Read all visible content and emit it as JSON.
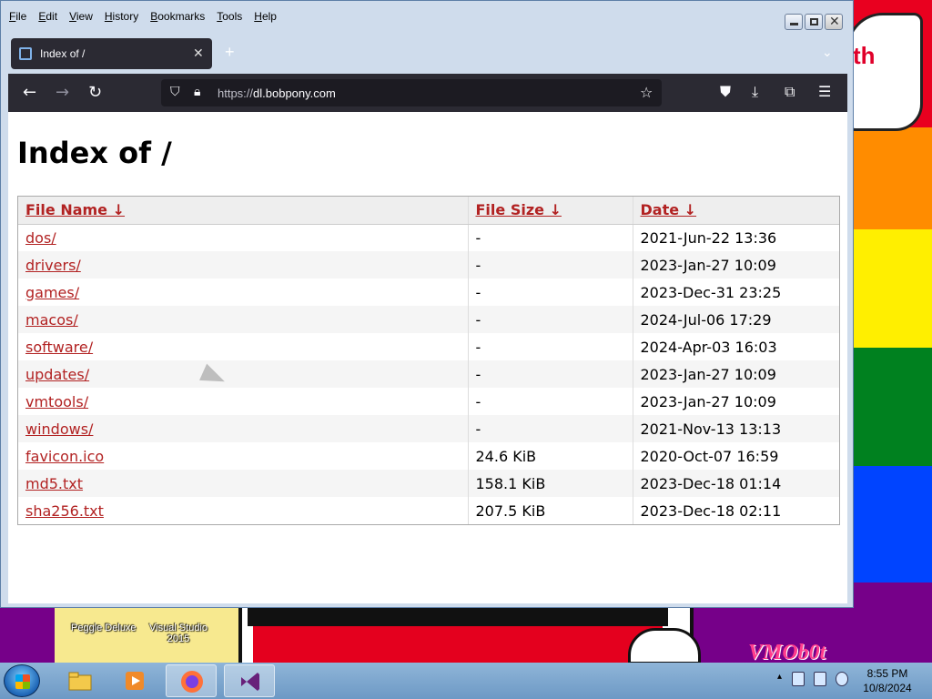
{
  "window": {
    "menu": [
      "File",
      "Edit",
      "View",
      "History",
      "Bookmarks",
      "Tools",
      "Help"
    ]
  },
  "tab": {
    "title": "Index of /"
  },
  "url": {
    "scheme": "https://",
    "host": "dl.bobpony.com"
  },
  "page": {
    "title": "Index of /",
    "headers": {
      "name": "File Name  ↓",
      "size": "File Size  ↓",
      "date": "Date  ↓"
    },
    "rows": [
      {
        "name": "dos/",
        "size": "-",
        "date": "2021-Jun-22 13:36"
      },
      {
        "name": "drivers/",
        "size": "-",
        "date": "2023-Jan-27 10:09"
      },
      {
        "name": "games/",
        "size": "-",
        "date": "2023-Dec-31 23:25"
      },
      {
        "name": "macos/",
        "size": "-",
        "date": "2024-Jul-06 17:29"
      },
      {
        "name": "software/",
        "size": "-",
        "date": "2024-Apr-03 16:03"
      },
      {
        "name": "updates/",
        "size": "-",
        "date": "2023-Jan-27 10:09"
      },
      {
        "name": "vmtools/",
        "size": "-",
        "date": "2023-Jan-27 10:09"
      },
      {
        "name": "windows/",
        "size": "-",
        "date": "2021-Nov-13 13:13"
      },
      {
        "name": "favicon.ico",
        "size": "24.6 KiB",
        "date": "2020-Oct-07 16:59"
      },
      {
        "name": "md5.txt",
        "size": "158.1 KiB",
        "date": "2023-Dec-18 01:14"
      },
      {
        "name": "sha256.txt",
        "size": "207.5 KiB",
        "date": "2023-Dec-18 02:11"
      }
    ]
  },
  "desktop": {
    "icon_label_1": "Peggle Deluxe",
    "icon_label_2": "Visual Studio 2015",
    "bubble_text": "th",
    "corner_text": "VMOb0t"
  },
  "taskbar": {
    "time": "8:55 PM",
    "date": "10/8/2024"
  },
  "colors": {
    "link": "#b22222",
    "browser_chrome": "#2b2a33"
  }
}
